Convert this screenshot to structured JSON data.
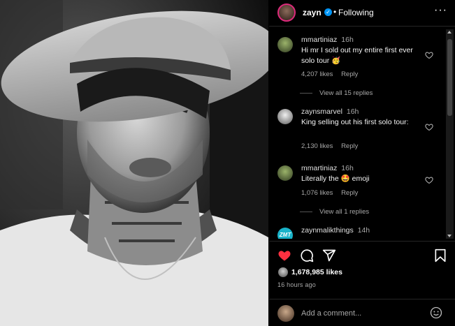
{
  "post": {
    "username": "zayn",
    "separator": "•",
    "follow_status": "Following",
    "more_glyph": "···"
  },
  "comments": [
    {
      "user": "mmartiniaz",
      "time": "16h",
      "text": "Hi mr I sold out my entire first ever solo tour 🥳",
      "likes": "4,207 likes",
      "reply": "Reply",
      "view_all": "View all 15 replies",
      "avatar_color": "#6a7a4a"
    },
    {
      "user": "zaynsmarvel",
      "time": "16h",
      "text": "King selling out his first solo tour:",
      "likes": "2,130 likes",
      "reply": "Reply",
      "avatar_color": "#dcdcdc"
    },
    {
      "user": "mmartiniaz",
      "time": "16h",
      "text": "Literally the 🤩 emoji",
      "likes": "1,076 likes",
      "reply": "Reply",
      "view_all": "View all 1 replies",
      "avatar_color": "#6a7a4a"
    },
    {
      "user": "zaynmalikthings",
      "time": "14h",
      "text": "",
      "avatar_label": "ZMT",
      "avatar_color": "#19b3c9"
    }
  ],
  "actions": {
    "like_count": "1,678,985 likes",
    "posted_ago": "16 hours ago",
    "comment_placeholder": "Add a comment...",
    "liked_color": "#ff3040"
  },
  "icons": [
    "verified-badge-icon",
    "more-options-icon",
    "heart-icon",
    "comment-icon",
    "share-icon",
    "bookmark-icon",
    "emoji-icon"
  ]
}
